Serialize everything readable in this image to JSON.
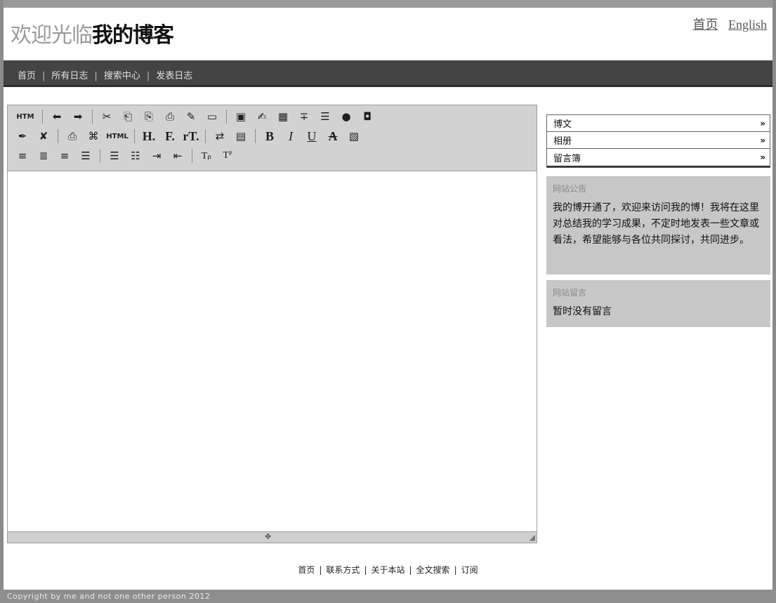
{
  "header": {
    "title_light": "欢迎光临",
    "title_dark": "我的博客",
    "links": [
      "首页",
      "English"
    ]
  },
  "nav": {
    "items": [
      "首页",
      "所有日志",
      "搜索中心",
      "发表日志"
    ],
    "separator": "|"
  },
  "editor": {
    "toolbar": {
      "html_label": "HTM",
      "html_label2": "HTML",
      "heading": "H.",
      "font": "F.",
      "size": "rT.",
      "bold": "B",
      "italic": "I",
      "underline": "U",
      "strike": "A",
      "sub": "Tₚ",
      "sup": "Tᴾ"
    }
  },
  "sidebar": {
    "menu": [
      {
        "label": "博文",
        "arrow": "»"
      },
      {
        "label": "相册",
        "arrow": "»"
      },
      {
        "label": "留言簿",
        "arrow": "»"
      }
    ],
    "notice": {
      "title": "网站公告",
      "body": "我的博开通了，欢迎来访问我的博！我将在这里对总结我的学习成果，不定时地发表一些文章或看法，希望能够与各位共同探讨，共同进步。"
    },
    "messages": {
      "title": "网站留言",
      "body": "暂时没有留言"
    }
  },
  "footer": {
    "links": [
      "首页",
      "联系方式",
      "关于本站",
      "全文搜索",
      "订阅"
    ],
    "copyright": "Copyright by me and not one other person 2012"
  }
}
